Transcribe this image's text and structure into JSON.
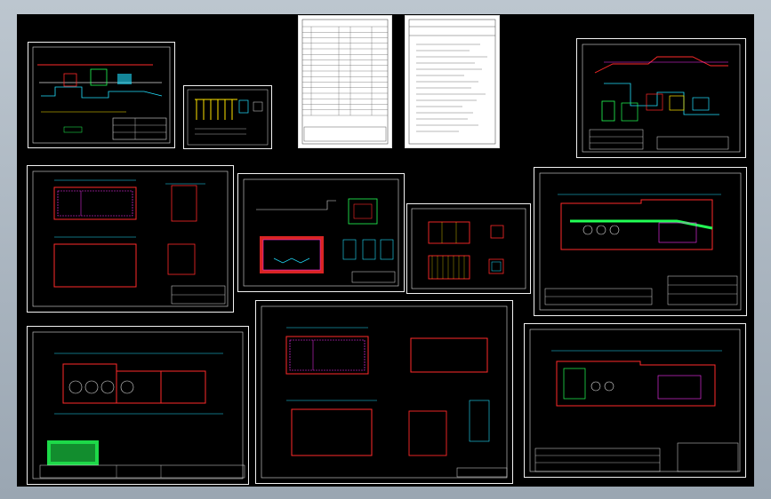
{
  "app": {
    "title": "",
    "colors": {
      "background": "#000000",
      "frame": "#a7b2bd",
      "sheet_border": "#f2f2f2",
      "cyan": "#22e0ff",
      "red": "#ff2a2a",
      "green": "#22ff55",
      "magenta": "#ff33ff",
      "yellow": "#ffe500",
      "white": "#ffffff"
    }
  },
  "sheets": [
    {
      "id": "process-flow-small",
      "kind": "process"
    },
    {
      "id": "equipment-chart",
      "kind": "yellow-chart"
    },
    {
      "id": "drawing-list",
      "kind": "table"
    },
    {
      "id": "design-notes",
      "kind": "notes"
    },
    {
      "id": "process-flow-large",
      "kind": "process"
    },
    {
      "id": "tank-plan-section",
      "kind": "tank"
    },
    {
      "id": "pipe-detail",
      "kind": "detail"
    },
    {
      "id": "cover-slab",
      "kind": "slab"
    },
    {
      "id": "site-plan-top",
      "kind": "site"
    },
    {
      "id": "general-layout",
      "kind": "layout"
    },
    {
      "id": "pool-structure",
      "kind": "tank"
    },
    {
      "id": "site-plan-bottom",
      "kind": "site"
    }
  ]
}
